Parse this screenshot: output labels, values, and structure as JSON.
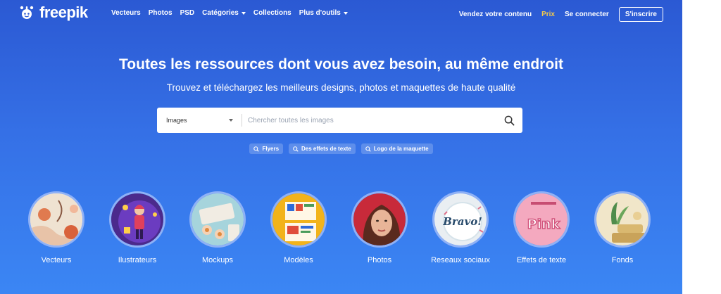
{
  "brand": {
    "name": "freepik"
  },
  "nav": {
    "links": [
      {
        "label": "Vecteurs",
        "dropdown": false
      },
      {
        "label": "Photos",
        "dropdown": false
      },
      {
        "label": "PSD",
        "dropdown": false
      },
      {
        "label": "Catégories",
        "dropdown": true
      },
      {
        "label": "Collections",
        "dropdown": false
      },
      {
        "label": "Plus d'outils",
        "dropdown": true
      }
    ],
    "sell": "Vendez votre contenu",
    "pricing": "Prix",
    "login": "Se connecter",
    "signup": "S'inscrire"
  },
  "hero": {
    "title": "Toutes les ressources dont vous avez besoin, au même endroit",
    "subtitle": "Trouvez et téléchargez les meilleurs designs, photos et maquettes de haute qualité"
  },
  "search": {
    "type_selected": "Images",
    "placeholder": "Chercher toutes les images"
  },
  "suggestions": [
    "Flyers",
    "Des effets de texte",
    "Logo de la maquette"
  ],
  "categories": [
    {
      "label": "Vecteurs",
      "icon": "vectors-thumbnail"
    },
    {
      "label": "Ilustrateurs",
      "icon": "illustrations-thumbnail"
    },
    {
      "label": "Mockups",
      "icon": "mockups-thumbnail"
    },
    {
      "label": "Modèles",
      "icon": "templates-thumbnail"
    },
    {
      "label": "Photos",
      "icon": "photos-thumbnail"
    },
    {
      "label": "Reseaux sociaux",
      "icon": "social-media-thumbnail",
      "thumb_text": "Bravo!"
    },
    {
      "label": "Effets de texte",
      "icon": "text-effects-thumbnail",
      "thumb_text": "Pink"
    },
    {
      "label": "Fonds",
      "icon": "backgrounds-thumbnail"
    }
  ],
  "colors": {
    "gradient_top": "#2b59d3",
    "gradient_bottom": "#3b86f4",
    "pricing": "#f2c94c"
  }
}
